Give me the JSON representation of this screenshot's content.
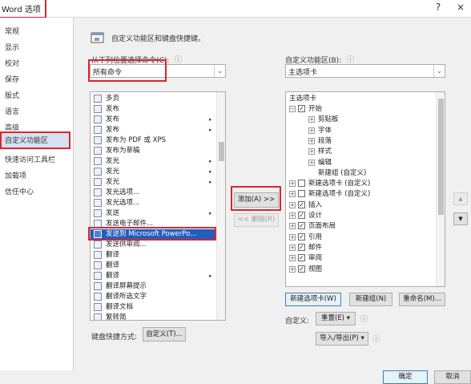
{
  "window": {
    "title": "Word 选项",
    "help": "?",
    "close": "×"
  },
  "nav": {
    "items": [
      {
        "label": "常规"
      },
      {
        "label": "显示"
      },
      {
        "label": "校对"
      },
      {
        "label": "保存"
      },
      {
        "label": "版式"
      },
      {
        "label": "语言"
      },
      {
        "label": "高级"
      },
      {
        "label": "自定义功能区"
      },
      {
        "label": "快速访问工具栏"
      },
      {
        "label": "加载项"
      },
      {
        "label": "信任中心"
      }
    ]
  },
  "main": {
    "description": "自定义功能区和键盘快捷键。",
    "choose_label": "从下列位置选择命令(C):",
    "choose_value": "所有命令",
    "ribbon_label": "自定义功能区(B):",
    "ribbon_value": "主选项卡",
    "info_glyph": "ⓘ",
    "commands": [
      {
        "label": "多页",
        "sub": ""
      },
      {
        "label": "发布",
        "sub": ""
      },
      {
        "label": "发布",
        "sub": "▸"
      },
      {
        "label": "发布",
        "sub": "▸"
      },
      {
        "label": "发布为 PDF 或 XPS",
        "sub": ""
      },
      {
        "label": "发布为草稿",
        "sub": ""
      },
      {
        "label": "发光",
        "sub": "▸"
      },
      {
        "label": "发光",
        "sub": "▸"
      },
      {
        "label": "发光",
        "sub": "▸"
      },
      {
        "label": "发光选项...",
        "sub": ""
      },
      {
        "label": "发光选项...",
        "sub": ""
      },
      {
        "label": "发送",
        "sub": "▸"
      },
      {
        "label": "发送电子邮件...",
        "sub": ""
      },
      {
        "label": "发送到 Microsoft PowerPo...",
        "sub": ""
      },
      {
        "label": "发送供审阅...",
        "sub": ""
      },
      {
        "label": "翻译",
        "sub": ""
      },
      {
        "label": "翻译",
        "sub": ""
      },
      {
        "label": "翻译",
        "sub": "▸"
      },
      {
        "label": "翻译屏幕提示",
        "sub": ""
      },
      {
        "label": "翻译所选文字",
        "sub": ""
      },
      {
        "label": "翻译文档",
        "sub": ""
      },
      {
        "label": "繁转简",
        "sub": ""
      }
    ],
    "add_button": "添加(A) >>",
    "remove_button": "<< 删除(R)",
    "tree_header": "主选项卡",
    "tree": [
      {
        "label": "开始",
        "level": 1,
        "exp": "−",
        "chk": "✓"
      },
      {
        "label": "剪贴板",
        "level": 2,
        "exp": "+",
        "chk": ""
      },
      {
        "label": "字体",
        "level": 2,
        "exp": "+",
        "chk": ""
      },
      {
        "label": "段落",
        "level": 2,
        "exp": "+",
        "chk": ""
      },
      {
        "label": "样式",
        "level": 2,
        "exp": "+",
        "chk": ""
      },
      {
        "label": "编辑",
        "level": 2,
        "exp": "+",
        "chk": ""
      },
      {
        "label": "新建组 (自定义)",
        "level": 2,
        "exp": "",
        "chk": ""
      },
      {
        "label": "新建选项卡 (自定义)",
        "level": 1,
        "exp": "+",
        "chk": " "
      },
      {
        "label": "新建选项卡 (自定义)",
        "level": 1,
        "exp": "+",
        "chk": " "
      },
      {
        "label": "插入",
        "level": 1,
        "exp": "+",
        "chk": "✓"
      },
      {
        "label": "设计",
        "level": 1,
        "exp": "+",
        "chk": "✓"
      },
      {
        "label": "页面布局",
        "level": 1,
        "exp": "+",
        "chk": "✓"
      },
      {
        "label": "引用",
        "level": 1,
        "exp": "+",
        "chk": "✓"
      },
      {
        "label": "邮件",
        "level": 1,
        "exp": "+",
        "chk": "✓"
      },
      {
        "label": "审阅",
        "level": 1,
        "exp": "+",
        "chk": "✓"
      },
      {
        "label": "视图",
        "level": 1,
        "exp": "+",
        "chk": "✓"
      }
    ],
    "new_tab_button": "新建选项卡(W)",
    "new_group_button": "新建组(N)",
    "rename_button": "重命名(M)...",
    "customize_label": "自定义:",
    "reset_button": "重置(E) ▾",
    "import_export_button": "导入/导出(P) ▾",
    "keyboard_label": "键盘快捷方式:",
    "keyboard_button": "自定义(T)...",
    "up_glyph": "▲",
    "down_glyph": "▼"
  },
  "footer": {
    "ok": "确定",
    "cancel": "取消"
  },
  "colors": {
    "highlight_red": "#d9262e",
    "selection_blue": "#1f5fbf"
  }
}
